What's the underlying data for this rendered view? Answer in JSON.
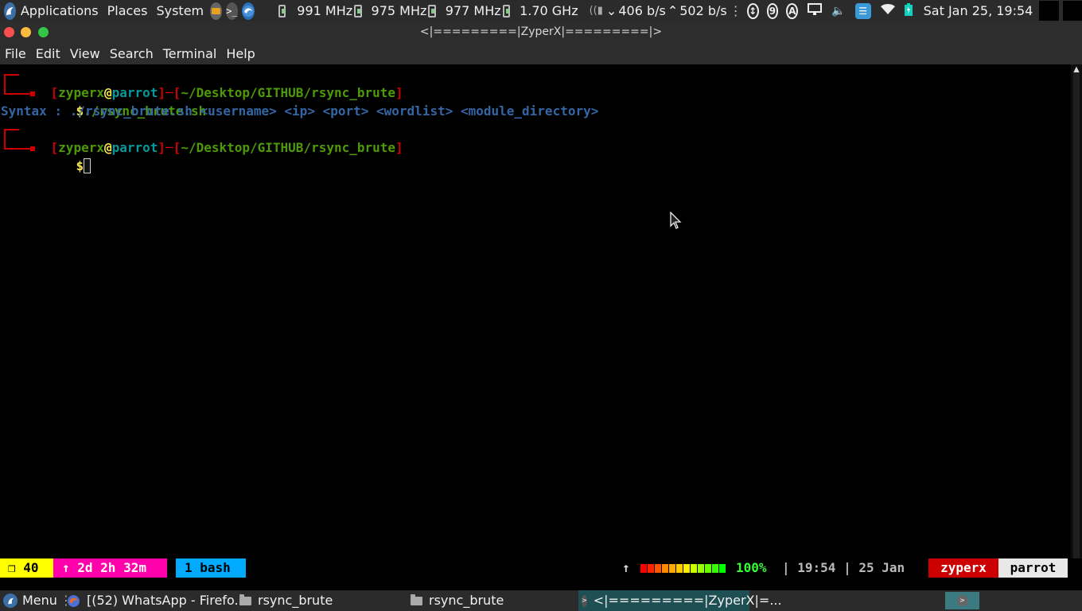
{
  "top_panel": {
    "menus": [
      "Applications",
      "Places",
      "System"
    ],
    "cpu_freqs": [
      "991 MHz",
      "975 MHz",
      "977 MHz",
      "1.70 GHz"
    ],
    "net_down": "406 b/s",
    "net_up": "502 b/s",
    "badges": [
      "9",
      "A"
    ],
    "clock": "Sat Jan 25, 19:54"
  },
  "window": {
    "title": "<|=========|ZyperX|=========|>"
  },
  "menubar": {
    "items": [
      "File",
      "Edit",
      "View",
      "Search",
      "Terminal",
      "Help"
    ]
  },
  "terminal": {
    "prompt1": {
      "user": "zyperx",
      "at": "@",
      "host": "parrot",
      "sep": "]─[",
      "path": "~/Desktop/GITHUB/rsync_brute",
      "command": "./rsync_brute.sh"
    },
    "output": "Syntax : ./rsync_brute.sh <username> <ip> <port> <wordlist> <module_directory>",
    "prompt2": {
      "user": "zyperx",
      "at": "@",
      "host": "parrot",
      "path": "~/Desktop/GITHUB/rsync_brute"
    },
    "dollar": "$"
  },
  "tmux": {
    "session": "❐ 40",
    "uptime": "↑ 2d 2h 32m",
    "window": "1 bash",
    "arrow": "↑",
    "battery": "100%",
    "time": "| 19:54 | 25 Jan",
    "user": "zyperx",
    "host": "parrot"
  },
  "taskbar": {
    "menu": "Menu",
    "items": [
      "[(52) WhatsApp - Firefo...",
      "rsync_brute",
      "rsync_brute",
      "<|=========|ZyperX|=..."
    ]
  },
  "colors": {
    "tmux_yellow": "#ffff00",
    "tmux_pink": "#ff00aa",
    "tmux_blue": "#00aaff",
    "tmux_red": "#cc0000",
    "tmux_white": "#e8e8e8",
    "prompt_red": "#cc0000",
    "prompt_green": "#4e9a06"
  }
}
